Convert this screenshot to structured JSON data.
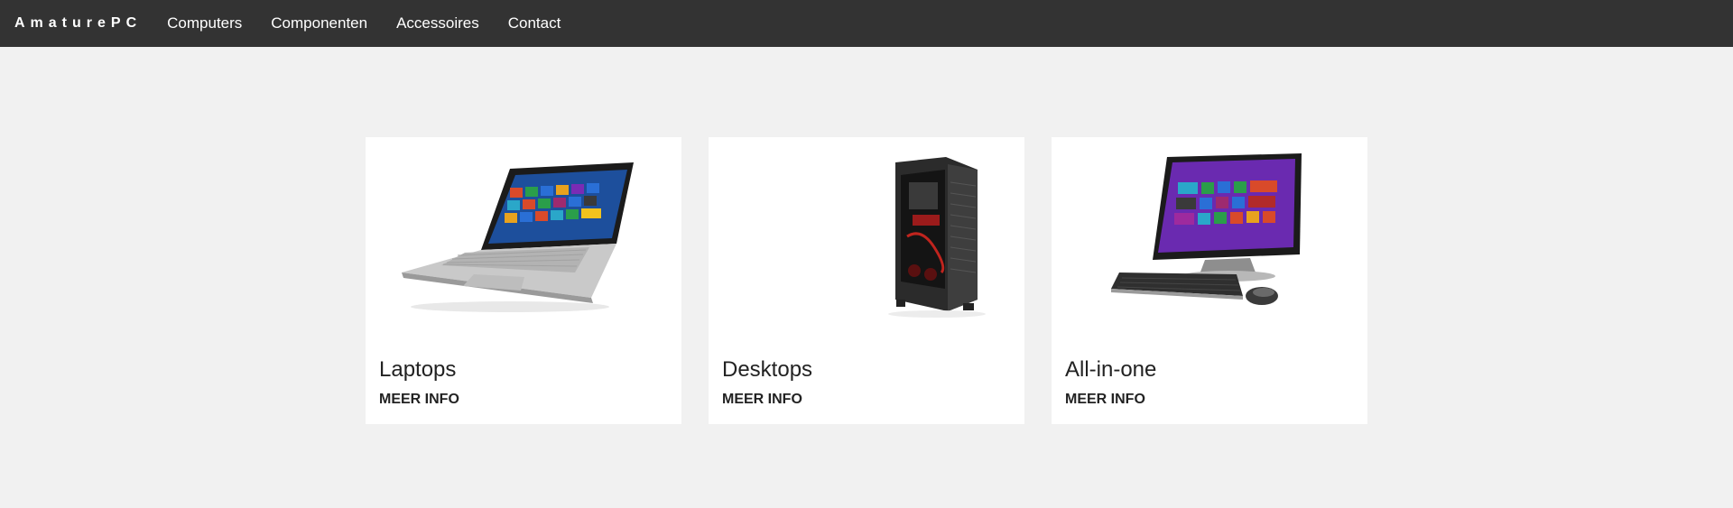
{
  "navbar": {
    "brand": "AmaturePC",
    "links": [
      "Computers",
      "Componenten",
      "Accessoires",
      "Contact"
    ]
  },
  "cards": [
    {
      "title": "Laptops",
      "link": "MEER INFO",
      "image_icon": "laptop-image"
    },
    {
      "title": "Desktops",
      "link": "MEER INFO",
      "image_icon": "desktop-tower-image"
    },
    {
      "title": "All-in-one",
      "link": "MEER INFO",
      "image_icon": "all-in-one-pc-image"
    }
  ],
  "colors": {
    "navbar_bg": "#333333",
    "page_bg": "#f1f1f1",
    "card_bg": "#ffffff",
    "windows_blue": "#2a6fd6",
    "windows_purple": "#7a2bb5"
  }
}
